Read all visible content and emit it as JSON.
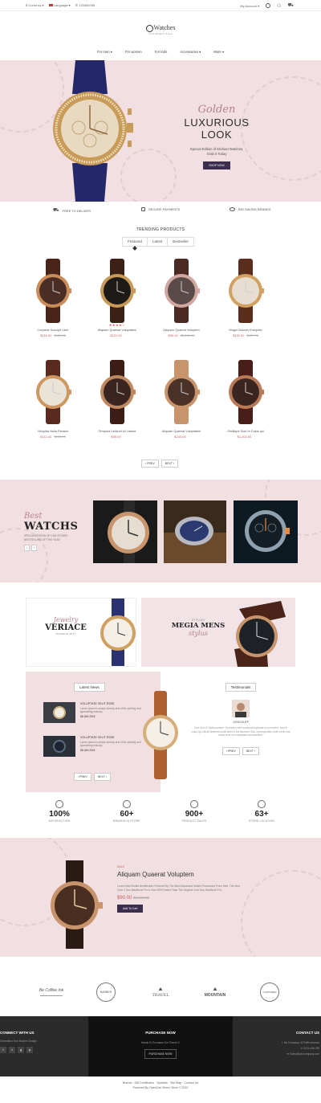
{
  "topbar": {
    "currency": "$ Currency",
    "language": "Language",
    "phone": "123456789",
    "account": "My Account"
  },
  "header": {
    "logo_name": "Watches",
    "logo_tagline": "Your Modern Store"
  },
  "nav": [
    {
      "label": "For men",
      "dropdown": true
    },
    {
      "label": "For women",
      "dropdown": false
    },
    {
      "label": "For Kids",
      "dropdown": false
    },
    {
      "label": "Accessories",
      "dropdown": true
    },
    {
      "label": "More",
      "dropdown": true
    }
  ],
  "hero": {
    "script": "Golden",
    "title": "LUXURIOUS LOOK",
    "sub1": "Special Edition of Michael Watches,",
    "sub2": "Grab it Today",
    "button": "SHOP NOW"
  },
  "features": [
    {
      "icon": "truck-icon",
      "label": "FREE TO DELIVER"
    },
    {
      "icon": "lock-icon",
      "label": "SECURE PAYMENTS"
    },
    {
      "icon": "piggy-bank-icon",
      "label": "BIG SAVING BRANDS"
    }
  ],
  "trending": {
    "title": "TRENDING PRODUCTS",
    "tabs": [
      "Featured",
      "Latest",
      "Bestseller"
    ],
    "products": [
      {
        "name": "Corpanis Suscipit Liber",
        "price": "$116.00",
        "old": "$122.00",
        "stars": "",
        "dial": "#4a2e25",
        "case": "#c98c5a",
        "strap": "#4a2418"
      },
      {
        "name": "Aliquam Quaerat Voluptatem",
        "price": "$122.00",
        "old": "",
        "stars": "★★★★☆",
        "dial": "#1e1a18",
        "case": "#c89a58",
        "strap": "#3a2015"
      },
      {
        "name": "Aliquam Quaerat Voluptem",
        "price": "$90.00",
        "old": "$2,000.00",
        "stars": "",
        "dial": "#5a4a48",
        "case": "#d0a8a0",
        "strap": "#4a2a22"
      },
      {
        "name": "Magni Dolores Eosquies",
        "price": "$115.00",
        "old": "$137.00",
        "stars": "",
        "dial": "#e6ded2",
        "case": "#d2a060",
        "strap": "#5a2d1c"
      },
      {
        "name": "Voluptas Nulla Pariatur",
        "price": "$112.40",
        "old": "$123.00",
        "stars": "",
        "dial": "#e9e3d8",
        "case": "#cf9760",
        "strap": "#5a2a1e"
      },
      {
        "name": "Tempora Incidunt Ut Labore",
        "price": "$98.00",
        "old": "",
        "stars": "",
        "dial": "#3a2520",
        "case": "#c08860",
        "strap": "#3c1d15"
      },
      {
        "name": "Aliquam Quaerat Voluptatem",
        "price": "$243.00",
        "old": "",
        "stars": "",
        "dial": "#4a3228",
        "case": "#c8946c",
        "strap": "#c8946c"
      },
      {
        "name": "Similique Sunt In Culpa qui",
        "price": "$1,202.00",
        "old": "",
        "stars": "",
        "dial": "#3c2520",
        "case": "#b87a58",
        "strap": "#4a1e18"
      }
    ],
    "prev": "PREV",
    "next": "NEXT"
  },
  "best": {
    "script": "Best",
    "title": "WATCHS",
    "desc": "SPECIAL EDITION OF OUR STORES BESTSELLING OF THIS YEAR"
  },
  "banners": {
    "left_script": "Jewelry",
    "left_title": "VERIACE",
    "left_small": "WOMENS 2017",
    "right_small": "STYLISH",
    "right_title": "MEGIA MENS",
    "right_script": "stylus"
  },
  "news": {
    "title": "Latest News",
    "items": [
      {
        "heading": "VOLUPTATE VELIT ESSE",
        "text": "Lorem Ipsum is simply dummy text of the printing and typesetting industry.",
        "date": "10",
        "month": "JAN 2018"
      },
      {
        "heading": "VOLUPTATE VELIT ESSE",
        "text": "Lorem Ipsum is simply dummy text of the printing and typesetting industry.",
        "date": "10",
        "month": "JAN 2018"
      }
    ],
    "prev": "PREV",
    "next": "NEXT"
  },
  "testimonials": {
    "title": "Testimonials",
    "name": "JOHN DUFF",
    "text": "Sunt Sunt In Nulla pariatur. Excepteur sint occaecat cupidatat non proident, sunt in culpa qui officia deserunt mollit anim id est laborum. Sed ut perspiciatis unde omnis iste natus error sit voluptatem accusantium.",
    "prev": "PREV",
    "next": "NEXT"
  },
  "counters": [
    {
      "icon": "smile-icon",
      "value": "100%",
      "label": "SATISFACTION"
    },
    {
      "icon": "heart-icon",
      "value": "60+",
      "label": "BRANDS IN STORE"
    },
    {
      "icon": "chat-icon",
      "value": "900+",
      "label": "PRODUCT SALES"
    },
    {
      "icon": "user-icon",
      "value": "63+",
      "label": "STORE LOCATION"
    }
  ],
  "deal": {
    "badge": "SALE",
    "title": "Aliquam Quaerat Voluptem",
    "desc": "Lorem Intel Mobile Architecture Powered By The Most Advanced Mobile Processors From Intel, The New Core 2 Duo MacBook Pro Is Over 50% Faster Than The Original Core Duo MacBook Pro.",
    "price": "$90.00",
    "old": "$2,000.00",
    "button": "Add To Cart"
  },
  "brands": [
    "Be Coffee Ink",
    "BARBER",
    "TRAVEL",
    "MOUNTAIN",
    "CUSTOMER"
  ],
  "footer": {
    "connect_title": "CONNECT WITH US",
    "connect_text": "Generation Your Modern Design",
    "purchase_title": "PURCHASE NOW",
    "purchase_text": "Hands To Purchase Our Theme !!!",
    "purchase_button": "PURCHASE NOW",
    "contact_title": "CONTACT US",
    "contact_address": "My Company, 42 Puffin Avenue",
    "contact_phone": "0123-456-789",
    "contact_email": "Sales@yourcompany.com",
    "links": "Brands · Gift Certificates · Specials · Site Map · Contact Us",
    "powered": "Powered By OpenCart Demo Store © 2022"
  },
  "colors": {
    "pink_bg": "#f2dfe2",
    "accent_red": "#c75d5d",
    "dark_button": "#3a2d4e"
  }
}
